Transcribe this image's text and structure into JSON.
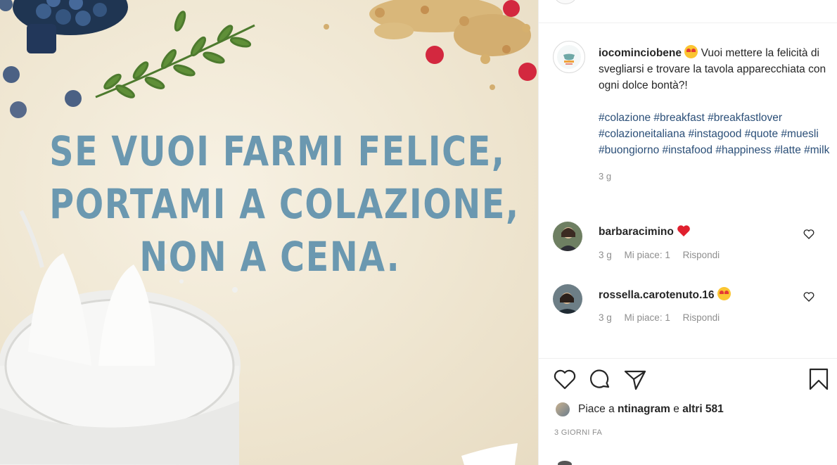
{
  "post": {
    "quote_lines": [
      "SE VUOI FARMI FELICE,",
      "PORTAMI A COLAZIONE,",
      "NON A CENA."
    ],
    "colors": {
      "quote": "#6b98b0",
      "background": "#efe6d1",
      "link": "#2b4f78",
      "muted": "#8e8e8e"
    }
  },
  "caption": {
    "username": "iocominciobene",
    "text": " Vuoi mettere la felicità di svegliarsi e trovare la tavola apparecchiata con ogni dolce bontà?!",
    "hashtags": "#colazione #breakfast #breakfastlover #colazioneitaliana #instagood #quote #muesli #buongiorno #instafood #happiness #latte #milk",
    "time": "3 g",
    "emoji_icon": "heart-eyes-emoji-icon"
  },
  "comments": [
    {
      "username": "barbaracimino",
      "emoji_icon": "red-heart-icon",
      "time": "3 g",
      "likes": "Mi piace: 1",
      "reply": "Rispondi"
    },
    {
      "username": "rossella.carotenuto.16",
      "emoji_icon": "heart-eyes-emoji-icon",
      "time": "3 g",
      "likes": "Mi piace: 1",
      "reply": "Rispondi"
    }
  ],
  "likes": {
    "prefix": "Piace a ",
    "user": "ntinagram",
    "middle": " e ",
    "others": "altri 581"
  },
  "date": "3 GIORNI FA",
  "icons": [
    "like-icon",
    "comment-icon",
    "share-icon",
    "bookmark-icon"
  ]
}
